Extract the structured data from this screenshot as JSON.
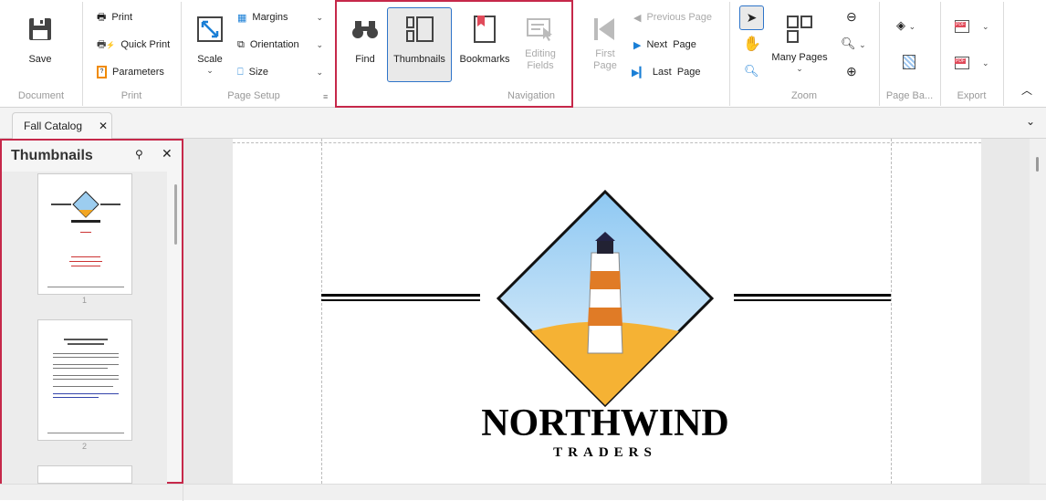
{
  "ribbon": {
    "document": {
      "group": "Document",
      "save": "Save"
    },
    "print": {
      "group": "Print",
      "print": "Print",
      "quick_print": "Quick Print",
      "parameters": "Parameters"
    },
    "page_setup": {
      "group": "Page Setup",
      "scale": "Scale",
      "margins": "Margins",
      "orientation": "Orientation",
      "size": "Size"
    },
    "navigation": {
      "group": "Navigation",
      "find": "Find",
      "thumbnails": "Thumbnails",
      "bookmarks": "Bookmarks",
      "editing_fields": "Editing Fields",
      "first_page": "First Page",
      "previous_page": "Previous Page",
      "next_page": "Next  Page",
      "last_page": "Last  Page"
    },
    "zoom": {
      "group": "Zoom",
      "many_pages": "Many Pages"
    },
    "page_background": {
      "group": "Page Ba..."
    },
    "export": {
      "group": "Export",
      "pdf": "PDF"
    }
  },
  "tabs": [
    {
      "label": "Fall Catalog"
    }
  ],
  "thumbnails_panel": {
    "title": "Thumbnails",
    "pages": [
      "1",
      "2"
    ]
  },
  "document": {
    "brand": "NORTHWIND",
    "sub": "TRADERS"
  },
  "colors": {
    "accent": "#2e74c9",
    "highlight": "#c6284a"
  }
}
